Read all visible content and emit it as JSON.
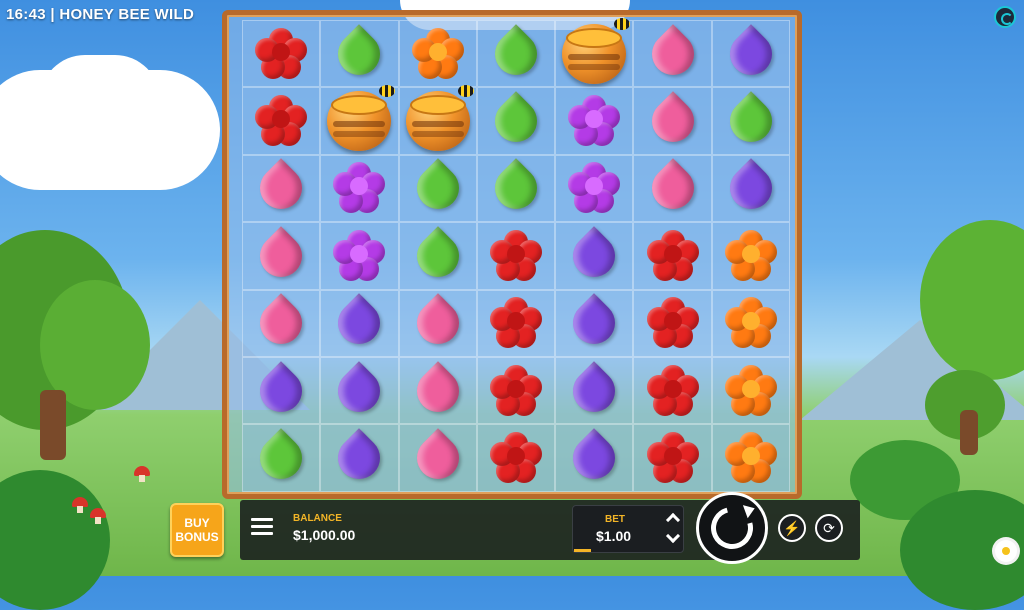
{
  "header": {
    "time": "16:43",
    "separator": " | ",
    "game_title": "HONEY BEE WILD",
    "settings_icon": "spiral-logo-icon"
  },
  "grid": {
    "columns": 7,
    "rows": 7,
    "cells": [
      [
        "red-flower",
        "green-leaf",
        "orange-flower",
        "green-leaf",
        "honey-pot",
        "pink-leaf",
        "purple-leaf"
      ],
      [
        "red-flower",
        "honey-pot",
        "honey-pot",
        "green-leaf",
        "magenta-flower",
        "pink-leaf",
        "green-leaf"
      ],
      [
        "pink-leaf",
        "magenta-flower",
        "green-leaf",
        "green-leaf",
        "magenta-flower",
        "pink-leaf",
        "purple-leaf"
      ],
      [
        "pink-leaf",
        "magenta-flower",
        "green-leaf",
        "red-flower",
        "purple-leaf",
        "red-flower",
        "orange-flower"
      ],
      [
        "pink-leaf",
        "purple-leaf",
        "pink-leaf",
        "red-flower",
        "purple-leaf",
        "red-flower",
        "orange-flower"
      ],
      [
        "purple-leaf",
        "purple-leaf",
        "pink-leaf",
        "red-flower",
        "purple-leaf",
        "red-flower",
        "orange-flower"
      ],
      [
        "green-leaf",
        "purple-leaf",
        "pink-leaf",
        "red-flower",
        "purple-leaf",
        "red-flower",
        "orange-flower"
      ]
    ]
  },
  "buy_bonus": {
    "line1": "BUY",
    "line2": "BONUS"
  },
  "balance": {
    "label": "BALANCE",
    "value": "$1,000.00"
  },
  "bet": {
    "label": "BET",
    "value": "$1.00",
    "level_fraction": 0.16
  },
  "controls": {
    "menu_icon": "hamburger-menu-icon",
    "spin_icon": "spin-arrow-icon",
    "turbo_icon": "lightning-icon",
    "autoplay_icon": "autoplay-icon",
    "turbo_glyph": "⚡",
    "autoplay_glyph": "⟳"
  },
  "colors": {
    "board_frame": "#b86a2b",
    "accent_gold": "#f3b527",
    "buy_bonus_bg": "#f6a51a"
  }
}
